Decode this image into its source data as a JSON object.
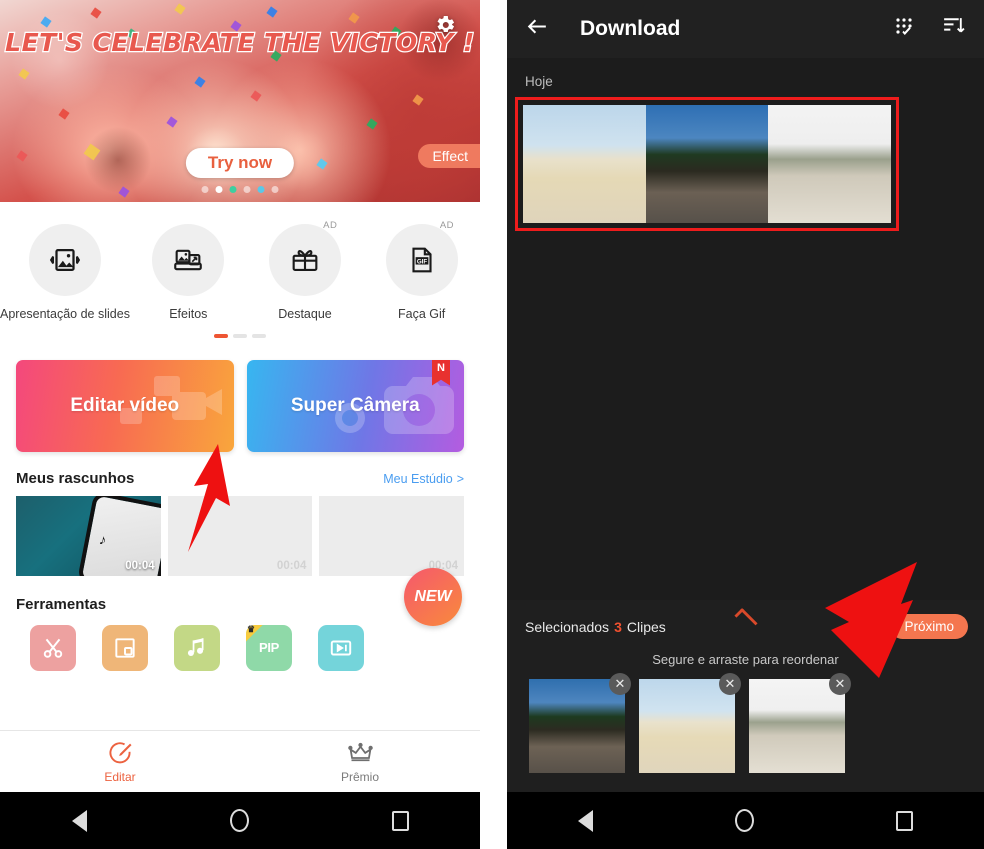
{
  "left_phone": {
    "banner": {
      "title": "LET'S CELEBRATE THE VICTORY !",
      "cta_label": "Try now",
      "effect_label": "Effect",
      "gear_icon": "gear-icon",
      "dots_count": 6,
      "active_dot_index": 1
    },
    "features": [
      {
        "label": "Apresentação de slides",
        "icon": "slideshow-icon",
        "ad": ""
      },
      {
        "label": "Efeitos",
        "icon": "effects-icon",
        "ad": ""
      },
      {
        "label": "Destaque",
        "icon": "gift-icon",
        "ad": "AD"
      },
      {
        "label": "Faça Gif",
        "icon": "gif-icon",
        "ad": "AD"
      }
    ],
    "feature_dots": {
      "count": 3,
      "active": 0
    },
    "cta": {
      "edit_video": "Editar vídeo",
      "super_camera": "Super Câmera",
      "new_badge": "N"
    },
    "drafts": {
      "title": "Meus rascunhos",
      "link": "Meu Estúdio",
      "link_chevron": ">",
      "items": [
        {
          "duration": "00:04",
          "has_thumb": true
        },
        {
          "duration": "00:04",
          "has_thumb": false
        },
        {
          "duration": "00:04",
          "has_thumb": false
        }
      ]
    },
    "tools": {
      "title": "Ferramentas",
      "new_bubble": "NEW",
      "items": [
        {
          "name": "trim-tool",
          "label": "✂",
          "color": "#eda1a0"
        },
        {
          "name": "crop-tool",
          "label": "▣",
          "color": "#efb678"
        },
        {
          "name": "music-tool",
          "label": "♫",
          "color": "#c3d886"
        },
        {
          "name": "pip-tool",
          "label": "PIP",
          "color": "#8fd9a8",
          "badge": "crown"
        },
        {
          "name": "video-tool",
          "label": "▶",
          "color": "#74d4da"
        }
      ]
    },
    "tabbar": [
      {
        "label": "Editar",
        "icon": "edit-pencil-icon",
        "active": true
      },
      {
        "label": "Prêmio",
        "icon": "crown-icon",
        "active": false
      }
    ]
  },
  "right_phone": {
    "header": {
      "back_icon": "back-arrow-icon",
      "title": "Download",
      "select_all_icon": "grid-check-icon",
      "sort_icon": "sort-list-icon"
    },
    "gallery": {
      "date_label": "Hoje",
      "highlight_color": "#ee1c1c",
      "items": [
        {
          "name": "beach-clip-1"
        },
        {
          "name": "beach-clip-2"
        },
        {
          "name": "beach-clip-3"
        }
      ]
    },
    "selection_bar": {
      "prefix": "Selecionados",
      "count": "3",
      "suffix": "Clipes",
      "collapse_icon": "chevron-up-icon",
      "next_label": "Próximo",
      "drag_hint": "Segure e arraste para reordenar",
      "clips": [
        {
          "name": "selected-clip-1",
          "remove": "✕"
        },
        {
          "name": "selected-clip-2",
          "remove": "✕"
        },
        {
          "name": "selected-clip-3",
          "remove": "✕"
        }
      ]
    }
  },
  "android_nav": {
    "back": "back-triangle-icon",
    "home": "home-circle-icon",
    "recents": "recents-square-icon"
  },
  "annotations": {
    "arrow_color": "#ee1111",
    "arrows": [
      {
        "name": "arrow-to-editar-video"
      },
      {
        "name": "arrow-to-proximo"
      }
    ]
  }
}
